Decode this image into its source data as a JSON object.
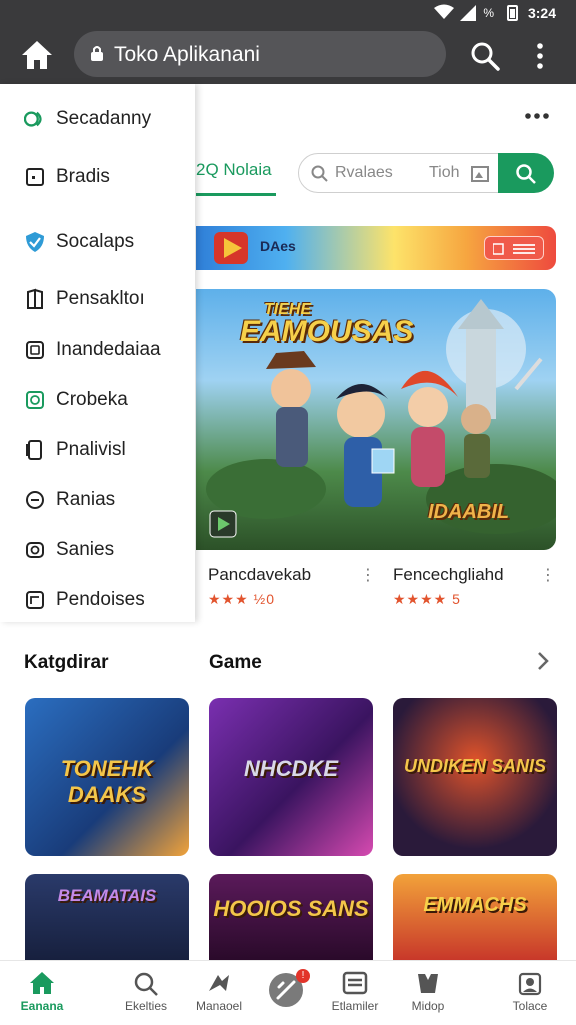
{
  "status_bar": {
    "battery": "%",
    "time": "3:24"
  },
  "url_bar": {
    "title": "Toko Aplikanani"
  },
  "drawer": {
    "items": [
      {
        "label": "Secadanny",
        "icon": "store-icon"
      },
      {
        "label": "Bradis",
        "icon": "square-icon"
      },
      {
        "label": "Socalaps",
        "icon": "shield-check-icon"
      },
      {
        "label": "Pensakltoı",
        "icon": "book-icon"
      },
      {
        "label": "Inandedaiaa",
        "icon": "gallery-icon"
      },
      {
        "label": "Crobeka",
        "icon": "circle-square-icon"
      },
      {
        "label": "Pnalivisl",
        "icon": "tablet-icon"
      },
      {
        "label": "Ranias",
        "icon": "stamp-icon"
      },
      {
        "label": "Sanies",
        "icon": "camera-icon"
      },
      {
        "label": "Pendoises",
        "icon": "frame-icon"
      }
    ]
  },
  "tabs": {
    "active": "2Q Nolaia"
  },
  "search": {
    "placeholder": "Rvalaes",
    "placeholder_extra": "Tioh"
  },
  "banner": {
    "label": "DAes"
  },
  "hero": {
    "title_top": "TIEHE",
    "title_main": "EAMOUSAS",
    "title_corner": "IDAABIL"
  },
  "featured": [
    {
      "name": "Pancdavekab",
      "rating_text": "★★★ ½0"
    },
    {
      "name": "Fencechgliahd",
      "rating_text": "★★★★ 5"
    }
  ],
  "sections": {
    "left_title": "Katgdirar",
    "right_title": "Game"
  },
  "game_cards": [
    {
      "title": "TONEHK DAAKS",
      "bg": "#2a6bb8"
    },
    {
      "title": "NHCDKE",
      "bg": "#7a2fb0"
    },
    {
      "title": "UNDIKEN SANIS",
      "bg": "#2a1a3a"
    },
    {
      "title": "BEAMATAIS",
      "bg": "#2a3a6a"
    },
    {
      "title": "HOOIOS SANS",
      "bg": "#4a1a5a"
    },
    {
      "title": "EMMACHS",
      "bg": "#d84a2a"
    }
  ],
  "nav": [
    {
      "label": "Eanana",
      "icon": "home-icon",
      "active": true
    },
    {
      "label": "Ekelties",
      "icon": "search-icon"
    },
    {
      "label": "Manaoel",
      "icon": "apps-icon"
    },
    {
      "label": "",
      "icon": "updates-icon",
      "badge": "!"
    },
    {
      "label": "Etlamiler",
      "icon": "library-icon"
    },
    {
      "label": "Midop",
      "icon": "shield-icon"
    },
    {
      "label": "Tolace",
      "icon": "account-icon"
    }
  ],
  "colors": {
    "accent": "#1a9a5e",
    "appbar": "#3a3a3c",
    "star": "#e2542e"
  }
}
